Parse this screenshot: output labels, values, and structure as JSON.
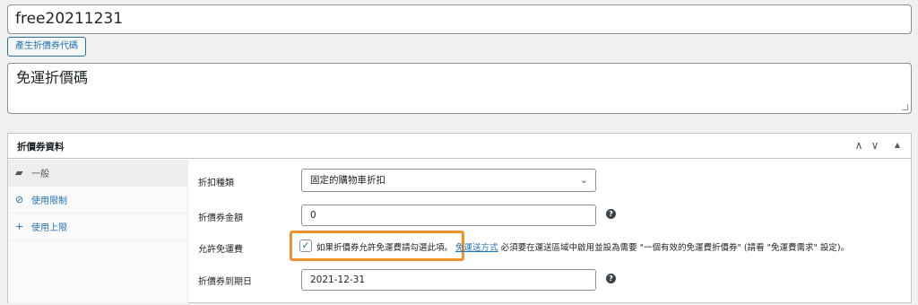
{
  "coupon": {
    "code": "free20211231",
    "generate_label": "產生折價券代碼",
    "description": "免運折價碼"
  },
  "panel": {
    "title": "折價券資料",
    "controls": {
      "up": "∧",
      "down": "∨",
      "toggle": "▲"
    }
  },
  "tabs": [
    {
      "icon": "▰",
      "label": "一般"
    },
    {
      "icon": "⊘",
      "label": "使用限制"
    },
    {
      "icon": "+",
      "label": "使用上限"
    }
  ],
  "fields": {
    "discount_type": {
      "label": "折扣種類",
      "value": "固定的購物車折扣"
    },
    "amount": {
      "label": "折價券金額",
      "value": "0"
    },
    "free_shipping": {
      "label": "允許免運費",
      "checked": true,
      "text": "如果折價券允許免運費請勾選此項。",
      "link": "免運送方式",
      "note": " 必須要在運送區域中啟用並設為需要 \"一個有效的免運費折價券\" (請看 \"免運費需求\" 設定)。"
    },
    "expiry": {
      "label": "折價券到期日",
      "value": "2021-12-31"
    }
  },
  "icons": {
    "help": "?",
    "check": "✓",
    "chevron": "⌄"
  },
  "colors": {
    "accent": "#2271b1",
    "highlight": "#f0922c"
  }
}
